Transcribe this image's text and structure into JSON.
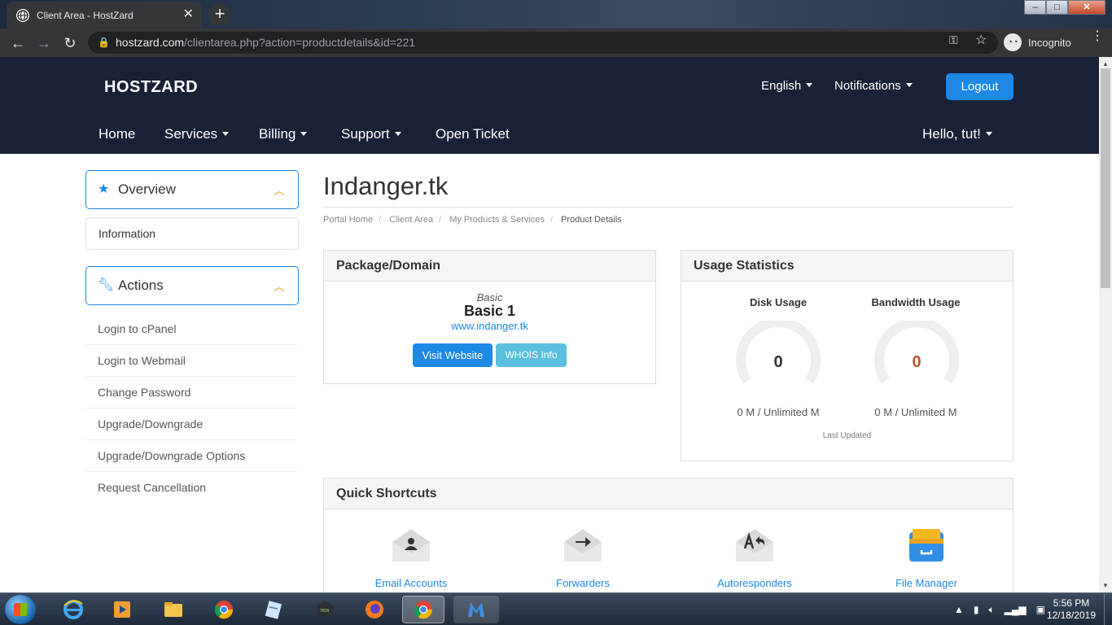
{
  "browser": {
    "tab_title": "Client Area - HostZard",
    "tab_close": "✕",
    "new_tab": "+",
    "url_host": "hostzard.com",
    "url_path": "/clientarea.php?action=productdetails&id=221",
    "incognito_label": "Incognito",
    "icons": [
      "back-arrow-icon",
      "forward-arrow-icon",
      "reload-icon",
      "lock-icon",
      "key-icon",
      "star-icon",
      "incognito-icon",
      "menu-dots-icon"
    ]
  },
  "header": {
    "logo": "HOSTZARD",
    "language": "English",
    "notifications": "Notifications",
    "logout": "Logout",
    "nav": {
      "home": "Home",
      "services": "Services",
      "billing": "Billing",
      "support": "Support",
      "open_ticket": "Open Ticket",
      "greeting": "Hello, tut!"
    }
  },
  "sidebar": {
    "overview": {
      "title": "Overview",
      "icon": "star-icon"
    },
    "information": "Information",
    "actions": {
      "title": "Actions",
      "icon": "wrench-icon",
      "items": [
        "Login to cPanel",
        "Login to Webmail",
        "Change Password",
        "Upgrade/Downgrade",
        "Upgrade/Downgrade Options",
        "Request Cancellation"
      ]
    }
  },
  "main": {
    "title": "Indanger.tk",
    "breadcrumb": [
      "Portal Home",
      "Client Area",
      "My Products & Services",
      "Product Details"
    ],
    "package": {
      "heading": "Package/Domain",
      "group": "Basic",
      "name": "Basic 1",
      "domain": "www.indanger.tk",
      "visit_button": "Visit Website",
      "whois_button": "WHOIS Info"
    },
    "usage": {
      "heading": "Usage Statistics",
      "disk_label": "Disk Usage",
      "disk_value": "0",
      "disk_text": "0 M / Unlimited M",
      "bandwidth_label": "Bandwidth Usage",
      "bandwidth_value": "0",
      "bandwidth_text": "0 M / Unlimited M",
      "last_updated": "Last Updated",
      "disk_value_color": "#333333",
      "bandwidth_value_color": "#c0562b"
    },
    "shortcuts": {
      "heading": "Quick Shortcuts",
      "items": [
        {
          "label": "Email Accounts",
          "icon": "email-accounts-icon"
        },
        {
          "label": "Forwarders",
          "icon": "forwarders-icon"
        },
        {
          "label": "Autoresponders",
          "icon": "autoresponders-icon"
        },
        {
          "label": "File Manager",
          "icon": "file-manager-icon"
        }
      ]
    }
  },
  "taskbar": {
    "apps": [
      "internet-explorer-icon",
      "media-player-icon",
      "file-explorer-icon",
      "chrome-icon",
      "notepad-icon",
      "nox-icon",
      "firefox-icon",
      "chrome-active-icon",
      "malwarebytes-icon"
    ],
    "time": "5:56 PM",
    "date": "12/18/2019"
  },
  "colors": {
    "header_bg": "#192137",
    "accent": "#1e88e5",
    "whois": "#5bc0de",
    "chevron": "#e8a317"
  }
}
